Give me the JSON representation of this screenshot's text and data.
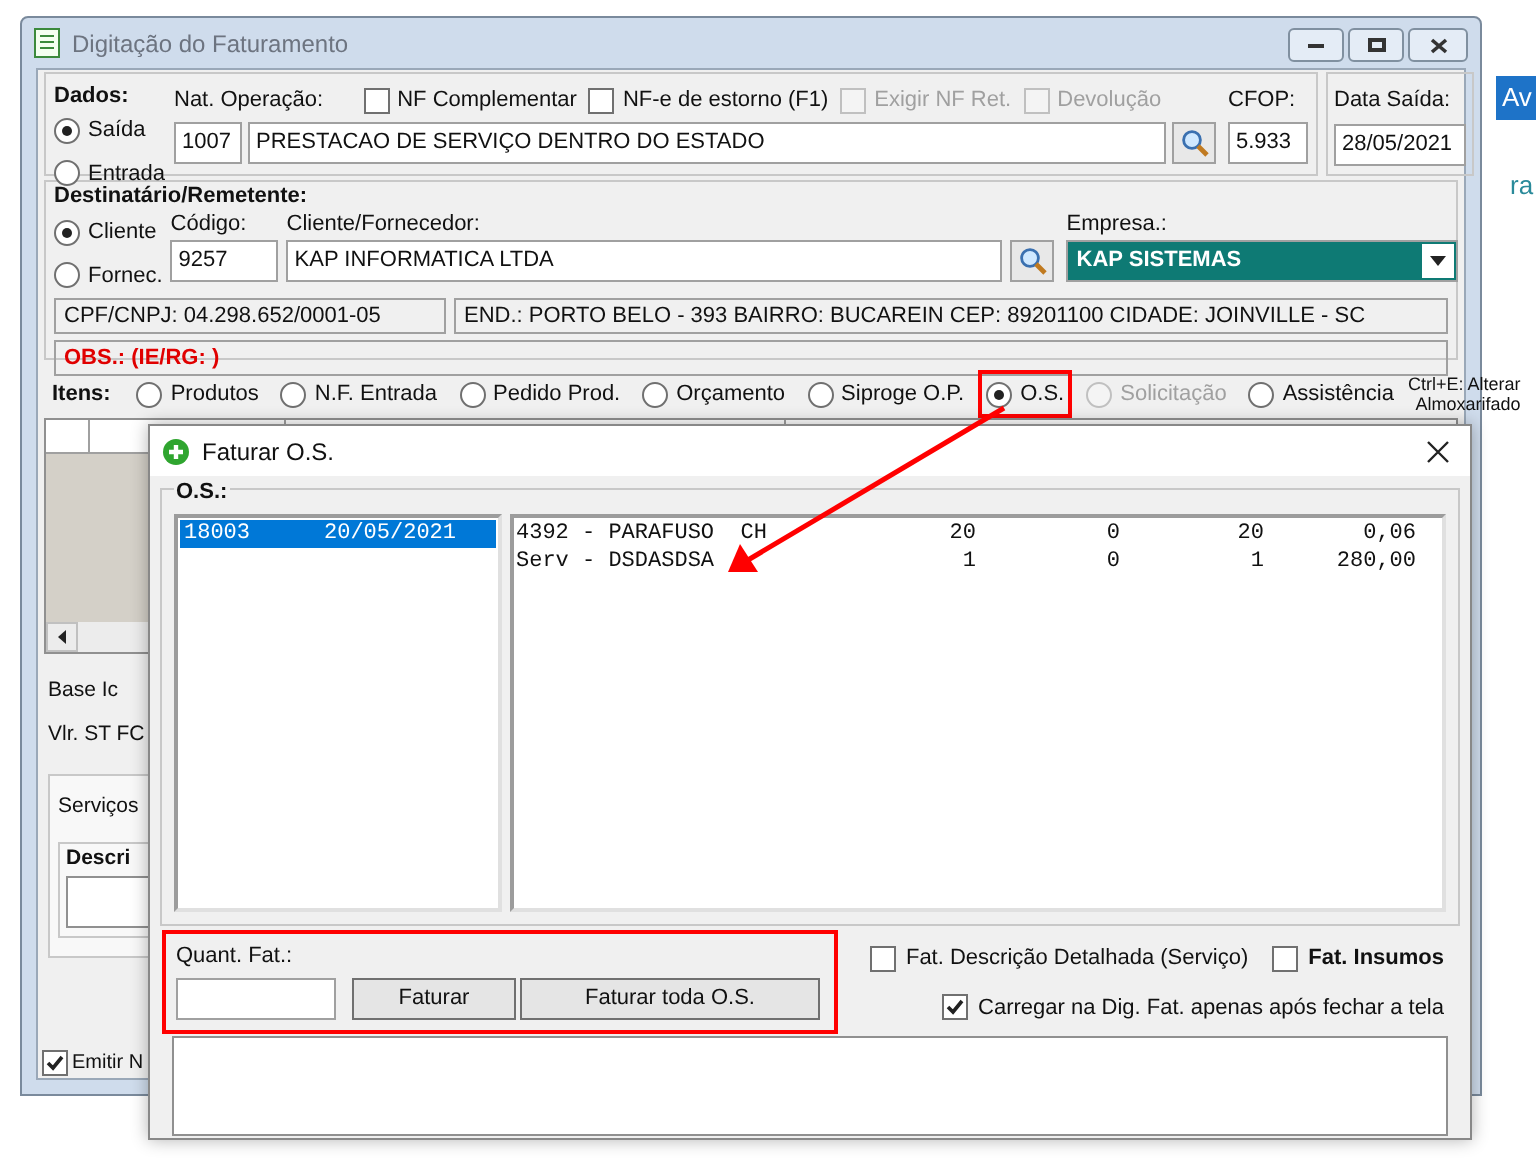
{
  "window": {
    "title": "Digitação do Faturamento"
  },
  "dados": {
    "label": "Dados:",
    "tipo": [
      {
        "label": "Saída",
        "selected": true
      },
      {
        "label": "Entrada",
        "selected": false
      }
    ],
    "nat_label": "Nat. Operação:",
    "options": [
      {
        "label": "NF Complementar",
        "checked": false,
        "disabled": false
      },
      {
        "label": "NF-e de estorno (F1)",
        "checked": false,
        "disabled": false
      },
      {
        "label": "Exigir NF Ret.",
        "checked": false,
        "disabled": true
      },
      {
        "label": "Devolução",
        "checked": false,
        "disabled": true
      }
    ],
    "nat_code": "1007",
    "nat_desc": "PRESTACAO DE SERVIÇO DENTRO DO ESTADO",
    "cfop_label": "CFOP:",
    "cfop": "5.933"
  },
  "data_saida": {
    "label": "Data Saída:",
    "value": "28/05/2021"
  },
  "destinatario": {
    "label": "Destinatário/Remetente:",
    "tipo": [
      {
        "label": "Cliente",
        "selected": true
      },
      {
        "label": "Fornec.",
        "selected": false
      }
    ],
    "codigo_label": "Código:",
    "codigo": "9257",
    "cliente_label": "Cliente/Fornecedor:",
    "cliente": "KAP INFORMATICA LTDA",
    "empresa_label": "Empresa.:",
    "empresa": "KAP SISTEMAS",
    "cpf": "CPF/CNPJ: 04.298.652/0001-05",
    "endereco": "END.: PORTO BELO - 393 BAIRRO: BUCAREIN CEP: 89201100 CIDADE: JOINVILLE - SC",
    "obs": "OBS.: (IE/RG: )"
  },
  "itens": {
    "label": "Itens:",
    "options": [
      {
        "label": "Produtos",
        "selected": false,
        "disabled": false,
        "highlighted": false
      },
      {
        "label": "N.F. Entrada",
        "selected": false,
        "disabled": false,
        "highlighted": false
      },
      {
        "label": "Pedido Prod.",
        "selected": false,
        "disabled": false,
        "highlighted": false
      },
      {
        "label": "Orçamento",
        "selected": false,
        "disabled": false,
        "highlighted": false
      },
      {
        "label": "Siproge O.P.",
        "selected": false,
        "disabled": false,
        "highlighted": false
      },
      {
        "label": "O.S.",
        "selected": true,
        "disabled": false,
        "highlighted": true
      },
      {
        "label": "Solicitação",
        "selected": false,
        "disabled": true,
        "highlighted": false
      },
      {
        "label": "Assistência",
        "selected": false,
        "disabled": false,
        "highlighted": false
      }
    ],
    "hint": [
      "Ctrl+E: Alterar",
      "Almoxarifado"
    ]
  },
  "totals": [
    "Base Ic",
    "Vlr. ST FC"
  ],
  "servicos": {
    "tab": "Serviços",
    "label": "Descri"
  },
  "emitir": {
    "label": "Emitir N",
    "checked": true
  },
  "dialog": {
    "title": "Faturar O.S.",
    "group": "O.S.:",
    "os_list": [
      {
        "number": "18003",
        "date": "20/05/2021",
        "selected": true
      }
    ],
    "items": [
      {
        "cells": [
          "4392 - PARAFUSO  CH",
          "20",
          "0",
          "20",
          "0,06"
        ]
      },
      {
        "cells": [
          "Serv - DSDASDSA",
          "1",
          "0",
          "1",
          "280,00"
        ]
      }
    ],
    "quant_label": "Quant. Fat.:",
    "quant_highlighted": true,
    "buttons": [
      "Faturar",
      "Faturar toda O.S."
    ],
    "options": [
      {
        "label": "Fat. Descrição Detalhada (Serviço)",
        "checked": false,
        "bold": false
      },
      {
        "label": "Fat. Insumos",
        "checked": false,
        "bold": true
      },
      {
        "label": "Carregar na Dig. Fat. apenas após fechar a tela",
        "checked": true,
        "bold": false
      }
    ]
  },
  "edge": [
    "Av",
    "ra"
  ]
}
